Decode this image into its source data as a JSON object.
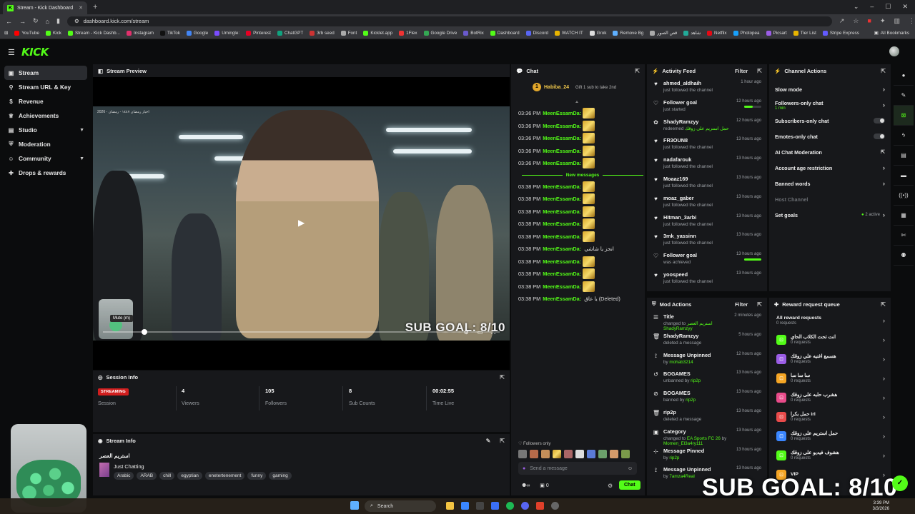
{
  "browser": {
    "tab_title": "Stream - Kick Dashboard",
    "url": "dashboard.kick.com/stream",
    "bookmarks": [
      "YouTube",
      "Kick",
      "Stream - Kick Dashb...",
      "Instagram",
      "TikTok",
      "Google",
      "Umingle:",
      "Pinterest",
      "ChatGPT",
      "3rb seed",
      "Font",
      "Kicklet.app",
      "1Flex",
      "Google Drive",
      "BotRix",
      "Dashboard",
      "Discord",
      "WATCH IT",
      "Grok",
      "Remove Bg",
      "قص الصور",
      "شاهد",
      "Netflix",
      "Photopea",
      "Picsart",
      "Tier List",
      "Stripe Express"
    ],
    "all_bookmarks": "All Bookmarks"
  },
  "app": {
    "logo": "KICK"
  },
  "sidebar": {
    "items": [
      {
        "label": "Stream",
        "icon": "broadcast-icon"
      },
      {
        "label": "Stream URL & Key",
        "icon": "link-icon"
      },
      {
        "label": "Revenue",
        "icon": "dollar-icon"
      },
      {
        "label": "Achievements",
        "icon": "trophy-icon"
      },
      {
        "label": "Studio",
        "icon": "folder-icon"
      },
      {
        "label": "Moderation",
        "icon": "shield-icon"
      },
      {
        "label": "Community",
        "icon": "users-icon"
      },
      {
        "label": "Drops & rewards",
        "icon": "gift-icon"
      }
    ]
  },
  "preview": {
    "title": "Stream Preview",
    "overlay_top": "2026 - اخبار رمضان ١٤٤٧ - رمضان",
    "sub_goal_overlay": "SUB GOAL: 8/10",
    "tooltip": "Mute (m)"
  },
  "session": {
    "title": "Session Info",
    "status_badge": "STREAMING",
    "status_label": "Session",
    "viewers": "4",
    "viewers_label": "Viewers",
    "followers": "105",
    "followers_label": "Followers",
    "subs": "8",
    "subs_label": "Sub Counts",
    "time": "00:02:55",
    "time_label": "Time Live"
  },
  "stream_info": {
    "title": "Stream Info",
    "stream_title": "استريم العصر",
    "category": "Just Chatting",
    "tags": [
      "Arabic",
      "ARAB",
      "chill",
      "egyptian",
      "enetertenement",
      "funny",
      "gaming"
    ]
  },
  "chat": {
    "title": "Chat",
    "pinned_user": "Habiba_24",
    "pinned_count": "1",
    "gift_text": "Gift 1 sub to take 2nd",
    "new_messages": "New messages",
    "messages_before": [
      {
        "time": "03:36 PM",
        "user": "MeenEssamDa:"
      },
      {
        "time": "03:36 PM",
        "user": "MeenEssamDa:"
      },
      {
        "time": "03:36 PM",
        "user": "MeenEssamDa:"
      },
      {
        "time": "03:36 PM",
        "user": "MeenEssamDa:"
      },
      {
        "time": "03:36 PM",
        "user": "MeenEssamDa:"
      }
    ],
    "messages_after": [
      {
        "time": "03:38 PM",
        "user": "MeenEssamDa:",
        "text": ""
      },
      {
        "time": "03:38 PM",
        "user": "MeenEssamDa:",
        "text": ""
      },
      {
        "time": "03:38 PM",
        "user": "MeenEssamDa:",
        "text": ""
      },
      {
        "time": "03:38 PM",
        "user": "MeenEssamDa:",
        "text": ""
      },
      {
        "time": "03:38 PM",
        "user": "MeenEssamDa:",
        "text": ""
      },
      {
        "time": "03:38 PM",
        "user": "MeenEssamDa:",
        "text": "انجز يا شاشي"
      },
      {
        "time": "03:38 PM",
        "user": "MeenEssamDa:",
        "text": ""
      },
      {
        "time": "03:38 PM",
        "user": "MeenEssamDa:",
        "text": ""
      },
      {
        "time": "03:38 PM",
        "user": "MeenEssamDa:",
        "text": ""
      },
      {
        "time": "03:38 PM",
        "user": "MeenEssamDa:",
        "text": "يا عاق (Deleted)"
      }
    ],
    "followers_only": "Followers only",
    "placeholder": "Send a message",
    "send_label": "Chat",
    "bottom_count": "0"
  },
  "activity": {
    "title": "Activity Feed",
    "filter": "Filter",
    "items": [
      {
        "name": "ahmed_aldhaih",
        "sub": "just followed the channel",
        "time": "1 hour ago",
        "icon": "heart-icon"
      },
      {
        "name": "Follower goal",
        "sub": "just started",
        "time": "12 hours ago",
        "icon": "heart-outline-icon",
        "progress": 0.5
      },
      {
        "name": "ShadyRamzyy",
        "sub": "redeemed",
        "sub_green": "حمل استريم على زوقك",
        "time": "12 hours ago",
        "icon": "reward-icon"
      },
      {
        "name": "FR3OUN8",
        "sub": "just followed the channel",
        "time": "13 hours ago",
        "icon": "heart-icon"
      },
      {
        "name": "nadafarouk",
        "sub": "just followed the channel",
        "time": "13 hours ago",
        "icon": "heart-icon"
      },
      {
        "name": "Moaaz169",
        "sub": "just followed the channel",
        "time": "13 hours ago",
        "icon": "heart-icon"
      },
      {
        "name": "moaz_gaber",
        "sub": "just followed the channel",
        "time": "13 hours ago",
        "icon": "heart-icon"
      },
      {
        "name": "Hitman_3arbi",
        "sub": "just followed the channel",
        "time": "13 hours ago",
        "icon": "heart-icon"
      },
      {
        "name": "3mk_yassinn",
        "sub": "just followed the channel",
        "time": "13 hours ago",
        "icon": "heart-icon"
      },
      {
        "name": "Follower goal",
        "sub": "was achieved",
        "time": "13 hours ago",
        "icon": "heart-outline-icon",
        "progress": 1.0
      },
      {
        "name": "yoospeed",
        "sub": "just followed the channel",
        "time": "13 hours ago",
        "icon": "heart-icon"
      }
    ]
  },
  "channel_actions": {
    "title": "Channel Actions",
    "items": [
      {
        "label": "Slow mode",
        "kind": "arrow"
      },
      {
        "label": "Followers-only chat",
        "sub": "1 min",
        "kind": "arrow"
      },
      {
        "label": "Subscribers-only chat",
        "kind": "toggle"
      },
      {
        "label": "Emotes-only chat",
        "kind": "toggle"
      },
      {
        "label": "AI Chat Moderation",
        "kind": "external"
      },
      {
        "label": "Account age restriction",
        "kind": "arrow"
      },
      {
        "label": "Banned words",
        "kind": "arrow"
      },
      {
        "label": "Host Channel",
        "kind": "disabled"
      },
      {
        "label": "Set goals",
        "extra": "2 active",
        "kind": "arrow"
      }
    ]
  },
  "mod_actions": {
    "title": "Mod Actions",
    "filter": "Filter",
    "items": [
      {
        "name": "Title",
        "sub": "changed to",
        "detail": "استريم العصر",
        "by": "ShadyRamzyy",
        "time": "2 minutes ago",
        "icon": "list-icon"
      },
      {
        "name": "ShadyRamzyy",
        "sub": "deleted a message",
        "time": "5 hours ago",
        "icon": "trash-icon"
      },
      {
        "name": "Message Unpinned",
        "sub": "by",
        "by": "mohab3214",
        "time": "12 hours ago",
        "icon": "unpin-icon"
      },
      {
        "name": "BOGAMES",
        "sub": "unbanned by",
        "by": "rip2p",
        "time": "13 hours ago",
        "icon": "undo-icon"
      },
      {
        "name": "BOGAMES",
        "sub": "banned by",
        "by": "rip2p",
        "time": "13 hours ago",
        "icon": "ban-icon"
      },
      {
        "name": "rip2p",
        "sub": "deleted a message",
        "time": "13 hours ago",
        "icon": "trash-icon"
      },
      {
        "name": "Category",
        "sub": "changed to",
        "detail": "EA Sports FC 26",
        "by2": "by",
        "by": "Momen_El3a4ry111",
        "time": "13 hours ago",
        "icon": "category-icon"
      },
      {
        "name": "Message Pinned",
        "sub": "by",
        "by": "rip2p",
        "time": "13 hours ago",
        "icon": "pin-icon"
      },
      {
        "name": "Message Unpinned",
        "sub": "by",
        "by": "7amza4Real",
        "time": "13 hours ago",
        "icon": "unpin-icon"
      }
    ]
  },
  "rewards": {
    "title": "Reward request queue",
    "items": [
      {
        "name": "All reward requests",
        "sub": "0 requests",
        "color": ""
      },
      {
        "name": "انت تحت الكلاب الحاي",
        "sub": "0 requests",
        "color": "#53fc18"
      },
      {
        "name": "هسمع اغنيه علي زوقك",
        "sub": "0 requests",
        "color": "#9b5de5"
      },
      {
        "name": "سا سا سا",
        "sub": "0 requests",
        "color": "#f5a524"
      },
      {
        "name": "هشرب حلبه على زوقك",
        "sub": "0 requests",
        "color": "#e94b8a"
      },
      {
        "name": "حمل بكرا irl",
        "sub": "0 requests",
        "color": "#e94b4b"
      },
      {
        "name": "حمل استريم على زوقك",
        "sub": "0 requests",
        "color": "#3a86ff"
      },
      {
        "name": "هشوف فيديو على زوقك",
        "sub": "0 requests",
        "color": "#53fc18"
      },
      {
        "name": "VIP",
        "sub": "",
        "color": "#f5a524"
      }
    ]
  },
  "overlay": {
    "sub_goal": "SUB GOAL: 8/10"
  },
  "taskbar": {
    "search": "Search",
    "time": "3:39 PM",
    "date": "3/3/2026"
  }
}
